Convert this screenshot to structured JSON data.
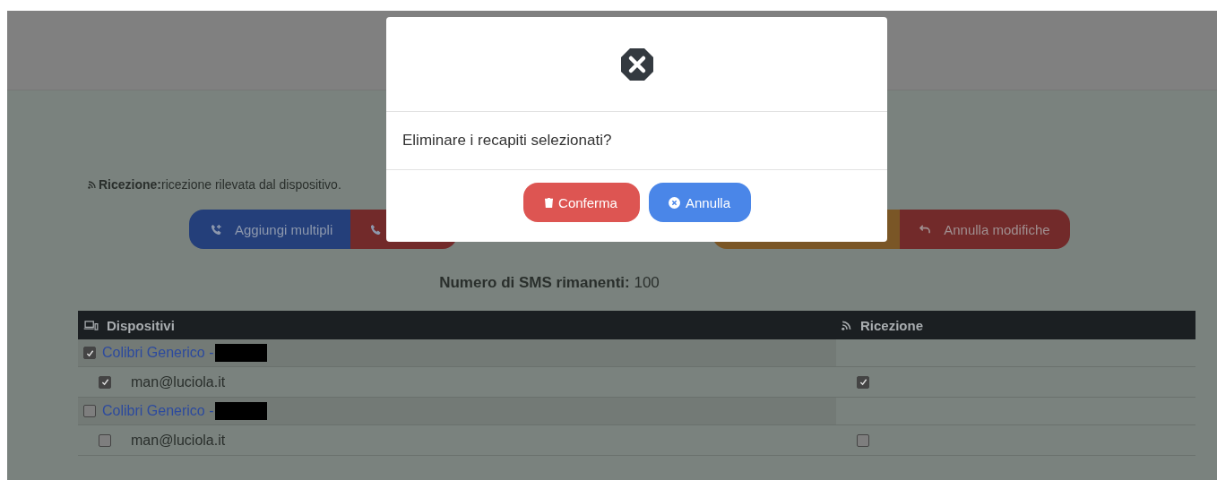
{
  "legend": {
    "label": "Ricezione:",
    "text": "ricezione rilevata dal dispositivo."
  },
  "toolbar_left": [
    {
      "kind": "add",
      "label": "Aggiungi multipli"
    },
    {
      "kind": "remove"
    }
  ],
  "toolbar_right": [
    {
      "kind": "save"
    },
    {
      "kind": "undo",
      "label": "Annulla modifiche"
    }
  ],
  "sms": {
    "label": "Numero di SMS rimanenti:",
    "value": "100"
  },
  "table": {
    "columns": [
      "Dispositivi",
      "Ricezione"
    ],
    "groups": [
      {
        "name": "Colibri Generico -",
        "checked": true,
        "contacts": [
          {
            "address": "man@luciola.it",
            "checked": true,
            "reception": true
          }
        ]
      },
      {
        "name": "Colibri Generico -",
        "checked": false,
        "contacts": [
          {
            "address": "man@luciola.it",
            "checked": false,
            "reception": false
          }
        ]
      }
    ]
  },
  "modal": {
    "message": "Eliminare i recapiti selezionati?",
    "buttons": [
      {
        "kind": "danger",
        "label": "Conferma"
      },
      {
        "kind": "primary",
        "label": "Annulla"
      }
    ]
  }
}
